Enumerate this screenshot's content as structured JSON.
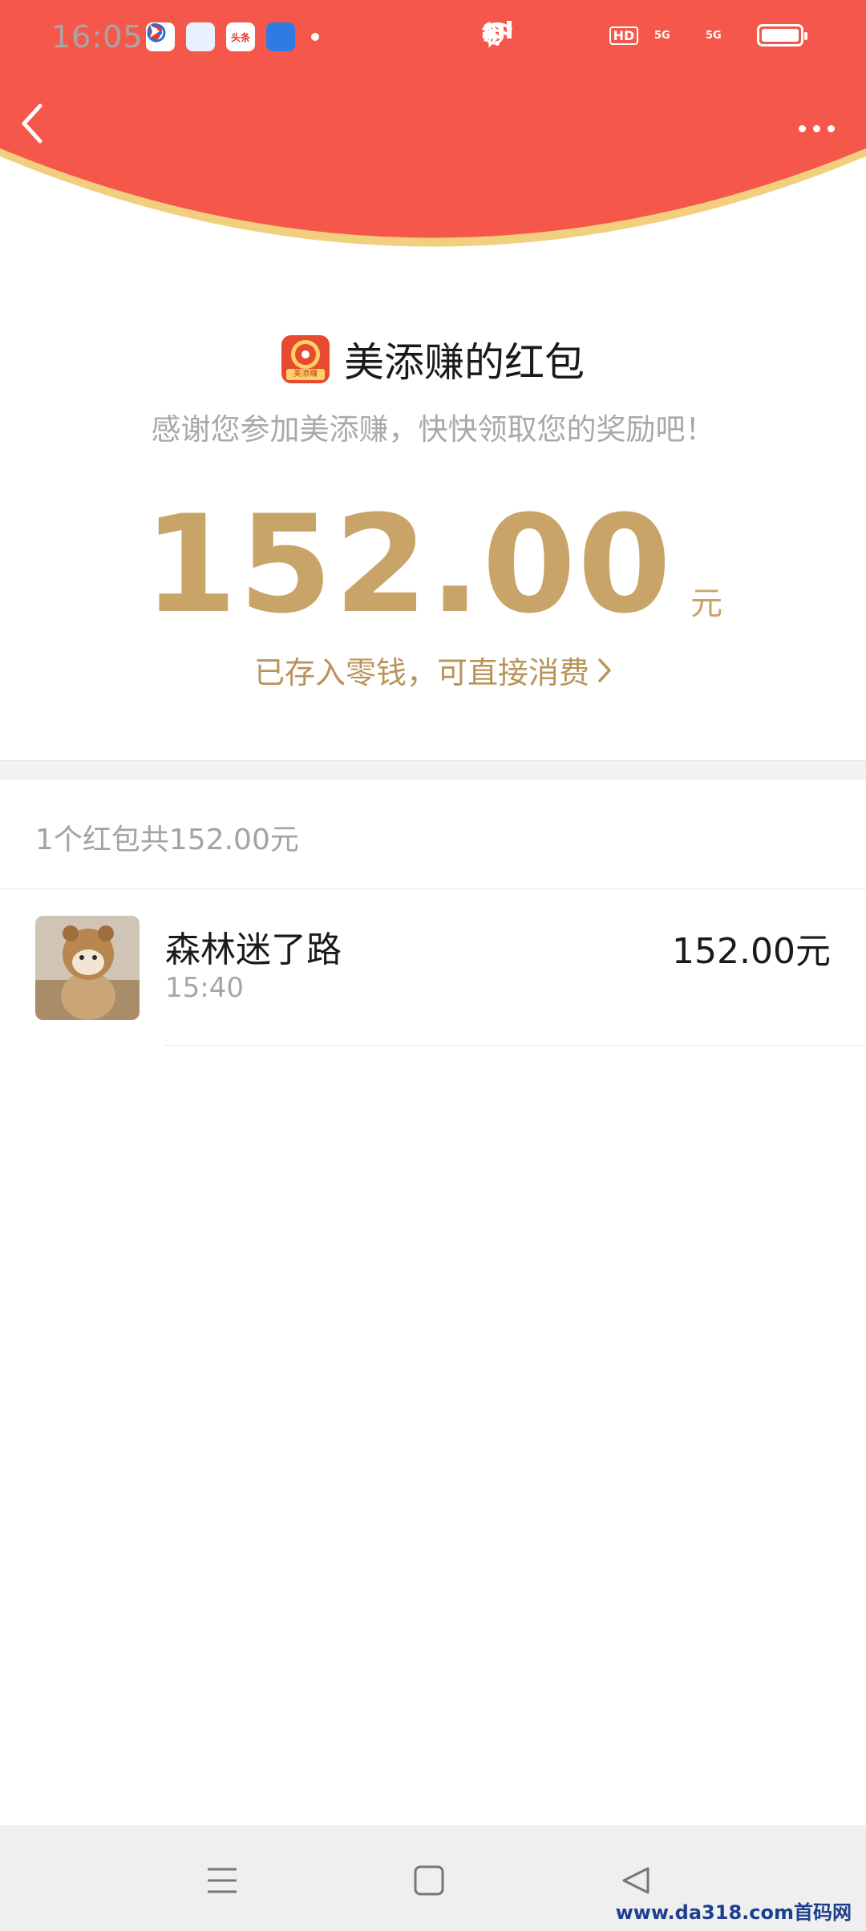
{
  "status_bar": {
    "time": "16:05",
    "apps": [
      {
        "icon": "map-pin-app-icon",
        "label": ""
      },
      {
        "icon": "browser-app-icon",
        "label": ""
      },
      {
        "icon": "toutiao-app-icon",
        "label": "头条"
      },
      {
        "icon": "feather-app-icon",
        "label": ""
      }
    ],
    "network_1": "5G",
    "network_2": "5G",
    "hd_label": "HD"
  },
  "header": {
    "bg_color": "#f5584a",
    "rim_color": "#f2cf7e"
  },
  "title": "美添赚的红包",
  "app_logo_text": "美添赚",
  "subtitle": "感谢您参加美添赚，快快领取您的奖励吧！",
  "amount": "152.00",
  "unit": "元",
  "deposit_text": "已存入零钱，可直接消费",
  "summary": "1个红包共152.00元",
  "list": [
    {
      "name": "森林迷了路",
      "time": "15:40",
      "amount": "152.00元"
    }
  ],
  "watermark": "www.da318.com首码网",
  "colors": {
    "gold": "#c9a468",
    "gray_text": "#a9a9a9"
  }
}
